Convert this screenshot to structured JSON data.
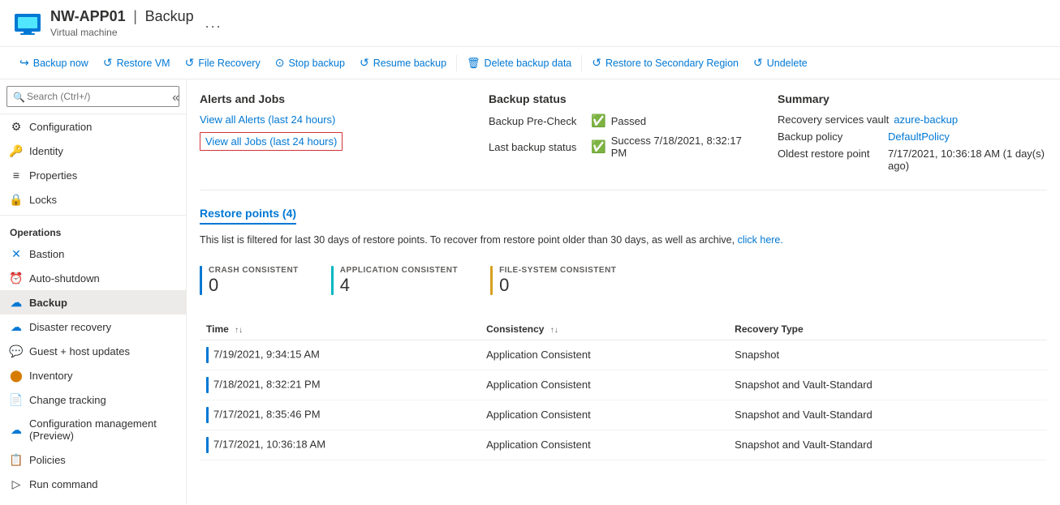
{
  "header": {
    "vm_name": "NW-APP01",
    "page_name": "Backup",
    "vm_type": "Virtual machine",
    "ellipsis": "..."
  },
  "toolbar": {
    "buttons": [
      {
        "id": "backup-now",
        "icon": "↩",
        "label": "Backup now",
        "icon_type": "backup"
      },
      {
        "id": "restore-vm",
        "icon": "↺",
        "label": "Restore VM",
        "icon_type": "restore"
      },
      {
        "id": "file-recovery",
        "icon": "↺",
        "label": "File Recovery",
        "icon_type": "file"
      },
      {
        "id": "stop-backup",
        "icon": "⊙",
        "label": "Stop backup",
        "icon_type": "stop"
      },
      {
        "id": "resume-backup",
        "icon": "↺",
        "label": "Resume backup",
        "icon_type": "resume"
      },
      {
        "id": "delete-backup",
        "icon": "🗑",
        "label": "Delete backup data",
        "icon_type": "delete"
      },
      {
        "id": "restore-secondary",
        "icon": "↺",
        "label": "Restore to Secondary Region",
        "icon_type": "restore2"
      },
      {
        "id": "undelete",
        "icon": "↺",
        "label": "Undelete",
        "icon_type": "undelete"
      }
    ]
  },
  "sidebar": {
    "search_placeholder": "Search (Ctrl+/)",
    "items": [
      {
        "id": "configuration",
        "label": "Configuration",
        "icon": "⚙",
        "section": ""
      },
      {
        "id": "identity",
        "label": "Identity",
        "icon": "🔑",
        "section": ""
      },
      {
        "id": "properties",
        "label": "Properties",
        "icon": "≡",
        "section": ""
      },
      {
        "id": "locks",
        "label": "Locks",
        "icon": "🔒",
        "section": ""
      },
      {
        "id": "operations-header",
        "label": "Operations",
        "icon": "",
        "section": "header"
      },
      {
        "id": "bastion",
        "label": "Bastion",
        "icon": "✕",
        "section": ""
      },
      {
        "id": "auto-shutdown",
        "label": "Auto-shutdown",
        "icon": "⏰",
        "section": ""
      },
      {
        "id": "backup",
        "label": "Backup",
        "icon": "☁",
        "section": "",
        "active": true
      },
      {
        "id": "disaster-recovery",
        "label": "Disaster recovery",
        "icon": "☁",
        "section": ""
      },
      {
        "id": "guest-host-updates",
        "label": "Guest + host updates",
        "icon": "💬",
        "section": ""
      },
      {
        "id": "inventory",
        "label": "Inventory",
        "icon": "🟠",
        "section": ""
      },
      {
        "id": "change-tracking",
        "label": "Change tracking",
        "icon": "📄",
        "section": ""
      },
      {
        "id": "config-management",
        "label": "Configuration management (Preview)",
        "icon": "☁",
        "section": ""
      },
      {
        "id": "policies",
        "label": "Policies",
        "icon": "📋",
        "section": ""
      },
      {
        "id": "run-command",
        "label": "Run command",
        "icon": "▷",
        "section": ""
      }
    ]
  },
  "content": {
    "alerts_jobs": {
      "title": "Alerts and Jobs",
      "alerts_link": "View all Alerts (last 24 hours)",
      "jobs_link": "View all Jobs (last 24 hours)"
    },
    "backup_status": {
      "title": "Backup status",
      "pre_check_label": "Backup Pre-Check",
      "pre_check_value": "Passed",
      "last_backup_label": "Last backup status",
      "last_backup_value": "Success 7/18/2021, 8:32:17 PM"
    },
    "summary": {
      "title": "Summary",
      "vault_label": "Recovery services vault",
      "vault_value": "azure-backup",
      "policy_label": "Backup policy",
      "policy_value": "DefaultPolicy",
      "oldest_label": "Oldest restore point",
      "oldest_value": "7/17/2021, 10:36:18 AM (1 day(s) ago)"
    },
    "restore_points": {
      "header": "Restore points (4)",
      "info_text": "This list is filtered for last 30 days of restore points. To recover from restore point older than 30 days, as well as archive,",
      "info_link": "click here.",
      "consistency_cards": [
        {
          "id": "crash",
          "label": "CRASH CONSISTENT",
          "count": "0",
          "color_class": "cc-blue"
        },
        {
          "id": "app",
          "label": "APPLICATION CONSISTENT",
          "count": "4",
          "color_class": "cc-teal"
        },
        {
          "id": "file",
          "label": "FILE-SYSTEM CONSISTENT",
          "count": "0",
          "color_class": "cc-yellow"
        }
      ],
      "table_headers": [
        {
          "id": "time",
          "label": "Time",
          "sortable": true
        },
        {
          "id": "consistency",
          "label": "Consistency",
          "sortable": true
        },
        {
          "id": "recovery-type",
          "label": "Recovery Type",
          "sortable": false
        }
      ],
      "table_rows": [
        {
          "time": "7/19/2021, 9:34:15 AM",
          "consistency": "Application Consistent",
          "recovery_type": "Snapshot"
        },
        {
          "time": "7/18/2021, 8:32:21 PM",
          "consistency": "Application Consistent",
          "recovery_type": "Snapshot and Vault-Standard"
        },
        {
          "time": "7/17/2021, 8:35:46 PM",
          "consistency": "Application Consistent",
          "recovery_type": "Snapshot and Vault-Standard"
        },
        {
          "time": "7/17/2021, 10:36:18 AM",
          "consistency": "Application Consistent",
          "recovery_type": "Snapshot and Vault-Standard"
        }
      ]
    }
  }
}
